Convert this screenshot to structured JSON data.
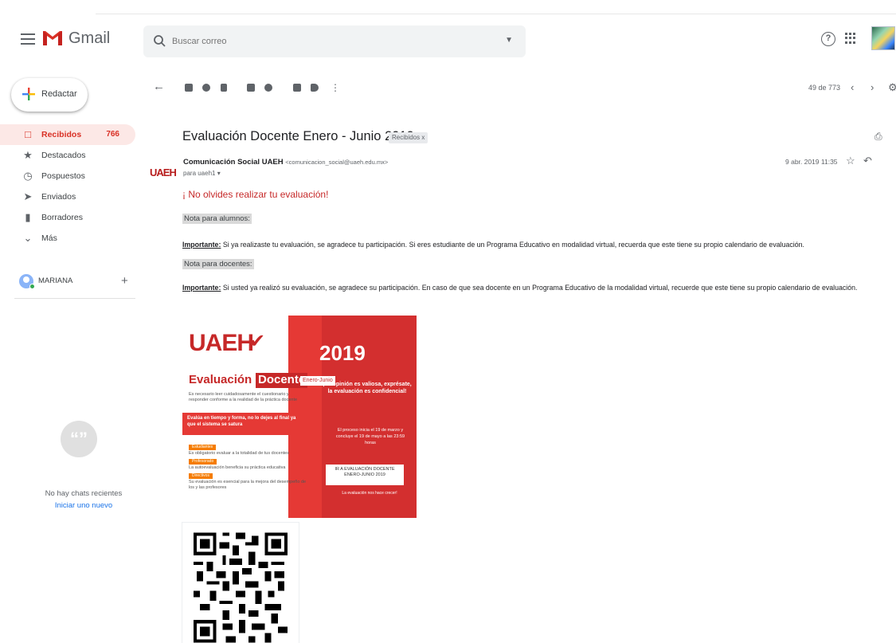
{
  "header": {
    "app_name": "Gmail",
    "search_placeholder": "Buscar correo"
  },
  "sidebar": {
    "compose_label": "Redactar",
    "items": [
      {
        "label": "Recibidos",
        "count": "766",
        "icon": "inbox-icon",
        "active": true
      },
      {
        "label": "Destacados",
        "count": "",
        "icon": "star-icon"
      },
      {
        "label": "Pospuestos",
        "count": "",
        "icon": "clock-icon"
      },
      {
        "label": "Enviados",
        "count": "",
        "icon": "send-icon"
      },
      {
        "label": "Borradores",
        "count": "",
        "icon": "draft-icon"
      },
      {
        "label": "Más",
        "count": "",
        "icon": "chevron-down-icon"
      }
    ],
    "hangouts_user": "MARIANA",
    "no_chats": "No hay chats recientes",
    "start_new": "Iniciar uno nuevo"
  },
  "toolbar": {
    "pager": "49 de 773"
  },
  "message": {
    "subject": "Evaluación Docente Enero - Junio 2019",
    "label_chip": "Recibidos x",
    "sender_name": "Comunicación Social UAEH",
    "sender_email": "<comunicacion_social@uaeh.edu.mx>",
    "recipient": "para uaeh1",
    "date": "9 abr. 2019 11:35",
    "avatar_text": "UAEH",
    "headline": "¡ No olvides realizar tu evaluación!",
    "students_header": "Nota para alumnos:",
    "students_important": "Importante:",
    "students_text": " Si ya realizaste tu evaluación, se agradece tu participación. Si eres estudiante de un Programa Educativo en modalidad virtual, recuerda que este tiene su propio calendario de evaluación.",
    "teachers_header": "Nota para docentes:",
    "teachers_important": "Importante:",
    "teachers_text": " Si usted ya realizó su evaluación, se agradece su participación. En caso de que sea docente en un Programa Educativo de la modalidad virtual, recuerde que este tiene su propio calendario de evaluación."
  },
  "flyer": {
    "logo": "UAEH",
    "year": "2019",
    "title_a": "Evaluación",
    "title_b": "Docente",
    "period": "Enero-Junio",
    "intro": "Es necesario leer cuidadosamente el cuestionario y responder conforme a la realidad de la práctica docente",
    "banner": "Evalúa en tiempo y forma, no lo dejes al final ya que el sistema se satura",
    "quote": "¡Tu opinión es valiosa, exprésate, la evaluación es confidencial!",
    "dates": "El proceso inicia el 19 de marzo y concluye el 19 de mayo a las 23:59 horas",
    "tag_1": "Estudiantes",
    "note_1": "Es obligatorio evaluar a la totalidad de tus docentes",
    "tag_2": "Profesorado",
    "note_2": "La autoevaluación beneficia su práctica educativa",
    "tag_3": "Directivos",
    "note_3": "Su evaluación es esencial para la mejora del desempeño de los y las profesores",
    "link_box": "IR A EVALUACIÓN DOCENTE ENERO-JUNIO 2019",
    "footer": "La evaluación nos hace crecer!"
  },
  "colors": {
    "accent_red": "#d93025",
    "uaeh_red": "#c62828",
    "flyer_red": "#e53935",
    "flyer_orange": "#f57c00",
    "link_blue": "#1a73e8"
  }
}
